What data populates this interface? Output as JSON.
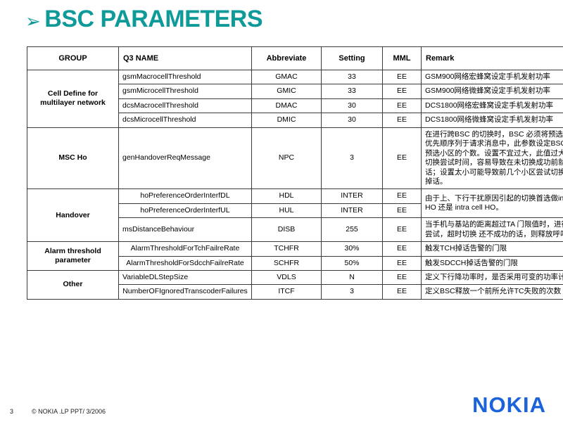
{
  "slide": {
    "title": "BSC PARAMETERS",
    "bullet_glyph": "➢",
    "title_color": "#0f9a9a"
  },
  "table": {
    "headers": [
      "GROUP",
      "Q3 NAME",
      "Abbreviate",
      "Setting",
      "MML",
      "Remark"
    ],
    "groups": [
      {
        "name": "Cell Define for multilayer network",
        "rows": [
          {
            "q3": "gsmMacrocellThreshold",
            "abbr": "GMAC",
            "setting": "33",
            "mml": "EE",
            "remark": "GSM900网络宏蜂窝设定手机发射功率"
          },
          {
            "q3": "gsmMicrocellThreshold",
            "abbr": "GMIC",
            "setting": "33",
            "mml": "EE",
            "remark": "GSM900网络微蜂窝设定手机发射功率"
          },
          {
            "q3": "dcsMacrocellThreshold",
            "abbr": "DMAC",
            "setting": "30",
            "mml": "EE",
            "remark": "DCS1800网络宏蜂窝设定手机发射功率"
          },
          {
            "q3": "dcsMicrocellThreshold",
            "abbr": "DMIC",
            "setting": "30",
            "mml": "EE",
            "remark": "DCS1800网络微蜂窝设定手机发射功率"
          }
        ]
      },
      {
        "name": "MSC Ho",
        "rows": [
          {
            "q3": "genHandoverReqMessage",
            "abbr": "NPC",
            "setting": "3",
            "mml": "EE",
            "remark": "在进行跨BSC 的切换时，BSC 必须将预选小区按优先顺序列于请求消息中，此参数设定BSC 所列预选小区的个数。设置不宜过大，此值过大将延长切换尝试时间，容易导致在未切换成功前就产生掉话；设置太小可能导致前几个小区尝试切换失败而掉话。"
          }
        ]
      },
      {
        "name": "Handover",
        "rows": [
          {
            "q3": "hoPreferenceOrderInterfDL",
            "abbr": "HDL",
            "setting": "INTER",
            "mml": "EE",
            "remark": "由于上、下行干扰原因引起的切换首选做inter cell HO 还是 intra cell HO。",
            "remark_rowspan": 2
          },
          {
            "q3": "hoPreferenceOrderInterfUL",
            "abbr": "HUL",
            "setting": "INTER",
            "mml": "EE",
            "remark": null
          },
          {
            "q3": "msDistanceBehaviour",
            "abbr": "DISB",
            "setting": "255",
            "mml": "EE",
            "remark": "当手机与基站的距离超过TA 门限值时，进行切换 尝试，超时切换 还不成功的话，则释放呼叫。"
          }
        ]
      },
      {
        "name": "Alarm threshold parameter",
        "rows": [
          {
            "q3": "AlarmThresholdForTchFailreRate",
            "abbr": "TCHFR",
            "setting": "30%",
            "mml": "EE",
            "remark": "触发TCH掉话告警的门限"
          },
          {
            "q3": "AlarmThresholdForSdcchFailreRate",
            "abbr": "SCHFR",
            "setting": "50%",
            "mml": "EE",
            "remark": "触发SDCCH掉话告警的门限"
          }
        ]
      },
      {
        "name": "Other",
        "rows": [
          {
            "q3": "VariableDLStepSize",
            "abbr": "VDLS",
            "setting": "N",
            "mml": "EE",
            "remark": "定义下行降功率时，是否采用可变的功率计算步长"
          },
          {
            "q3": "NumberOFIgnoredTranscoderFailures",
            "abbr": "ITCF",
            "setting": "3",
            "mml": "EE",
            "remark": "定义BSC释放一个前所允许TC失败的次数"
          }
        ]
      }
    ]
  },
  "footer": {
    "page_number": "3",
    "copyright": "© NOKIA .LP PPT/ 3/2006",
    "logo_text": "NOKIA",
    "logo_color": "#1b63da"
  }
}
